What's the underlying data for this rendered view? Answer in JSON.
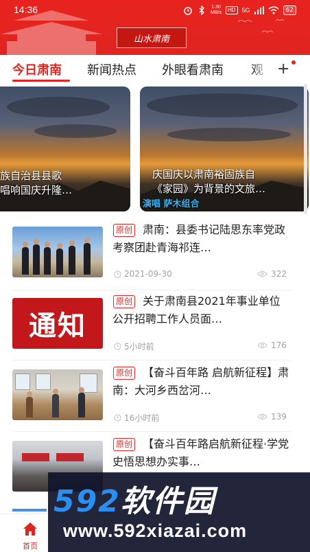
{
  "status_bar": {
    "time": "14:36",
    "net_speed_value": "1.30",
    "net_speed_unit": "MB/s",
    "hd_label": "HD",
    "network_label": "5G",
    "battery": "62"
  },
  "header": {
    "logo_text": "山水肃南"
  },
  "tabs": {
    "items": [
      "今日肃南",
      "新闻热点",
      "外眼看肃南",
      "观"
    ],
    "active_index": 0,
    "add_label": "+"
  },
  "carousel": {
    "cards": [
      {
        "title_line1": "族自治县县歌",
        "title_line2": "唱响国庆升隆…"
      },
      {
        "title_line1": "庆国庆以肃南裕固族自",
        "title_line2": "《家园》为背景的文旅…",
        "subtitle": "演唱 萨木组合"
      }
    ]
  },
  "news": [
    {
      "badge": "原创",
      "title": "肃南：县委书记陆思东率党政考察团赴青海祁连…",
      "time": "2021-09-30",
      "views": "322"
    },
    {
      "badge": "原创",
      "title": "关于肃南县2021年事业单位公开招聘工作人员面…",
      "time": "5小时前",
      "views": "176",
      "thumb_text": "通知"
    },
    {
      "badge": "原创",
      "title": "【奋斗百年路 启航新征程】肃南：大河乡西岔河…",
      "time": "16小时前",
      "views": "139"
    },
    {
      "badge": "原创",
      "title": "【奋斗百年路启航新征程·学党史悟思想办实事…",
      "time": "",
      "views": ""
    }
  ],
  "bottom_nav": {
    "home_label": "首页"
  },
  "watermark": {
    "brand_num": "592",
    "brand_cn": "软件园",
    "url": "www.592xiazai.com"
  },
  "colors": {
    "accent": "#e02420",
    "header_bg": "#e8231f",
    "muted": "#a0a0a0"
  }
}
